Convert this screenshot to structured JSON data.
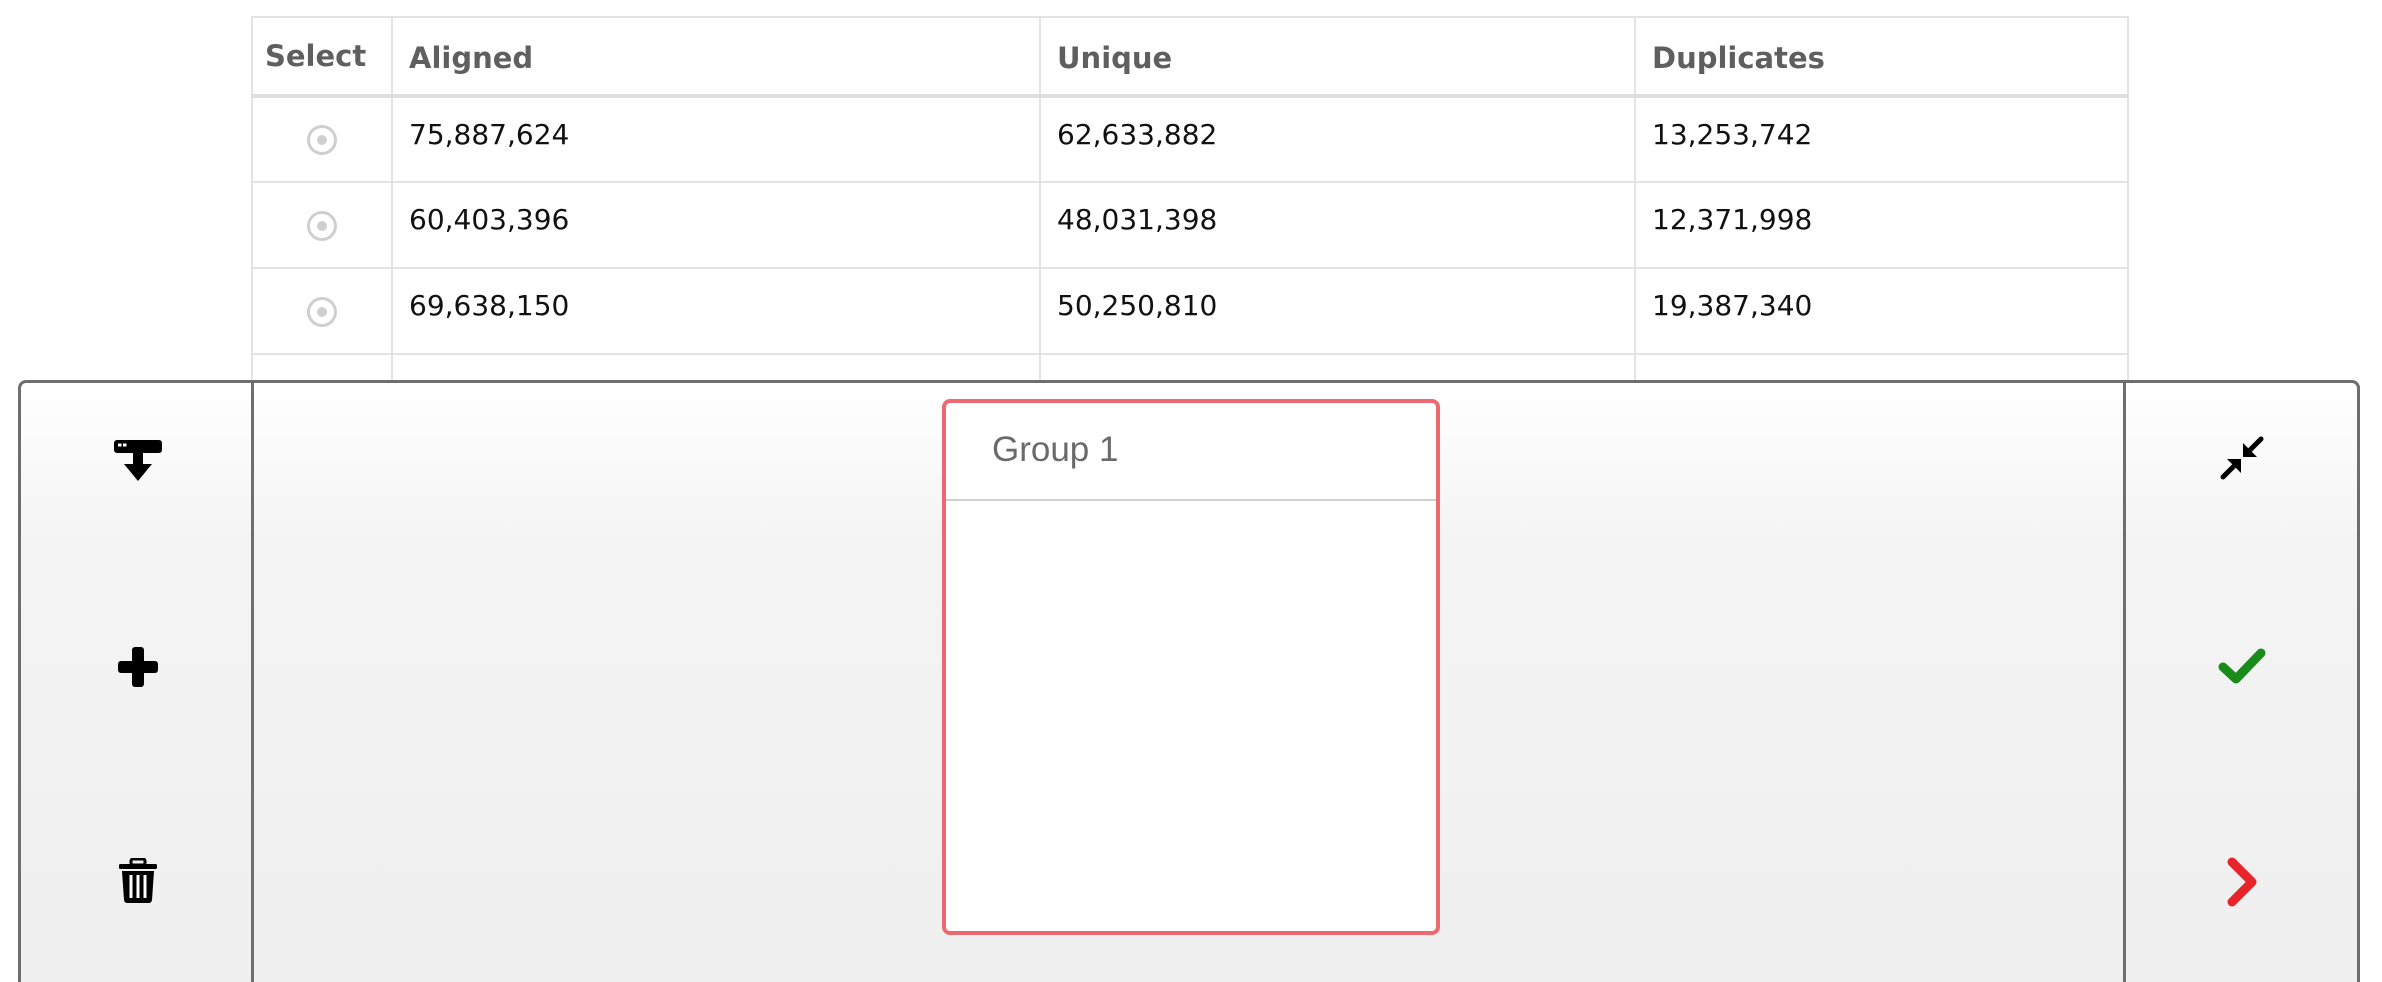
{
  "table": {
    "headers": [
      "Select",
      "Aligned",
      "Unique",
      "Duplicates"
    ],
    "rows": [
      {
        "aligned": "75,887,624",
        "unique": "62,633,882",
        "duplicates": "13,253,742"
      },
      {
        "aligned": "60,403,396",
        "unique": "48,031,398",
        "duplicates": "12,371,998"
      },
      {
        "aligned": "69,638,150",
        "unique": "50,250,810",
        "duplicates": "19,387,340"
      }
    ]
  },
  "panel": {
    "left_buttons": [
      {
        "icon": "download-to-group-icon"
      },
      {
        "icon": "plus-icon"
      },
      {
        "icon": "trash-icon"
      }
    ],
    "right_buttons": [
      {
        "icon": "compress-icon"
      },
      {
        "icon": "check-icon",
        "color": "#1a8a1a"
      },
      {
        "icon": "chevron-right-icon",
        "color": "#e8232a"
      }
    ],
    "group": {
      "title": "Group 1",
      "border_color": "#ec6a6f"
    }
  }
}
